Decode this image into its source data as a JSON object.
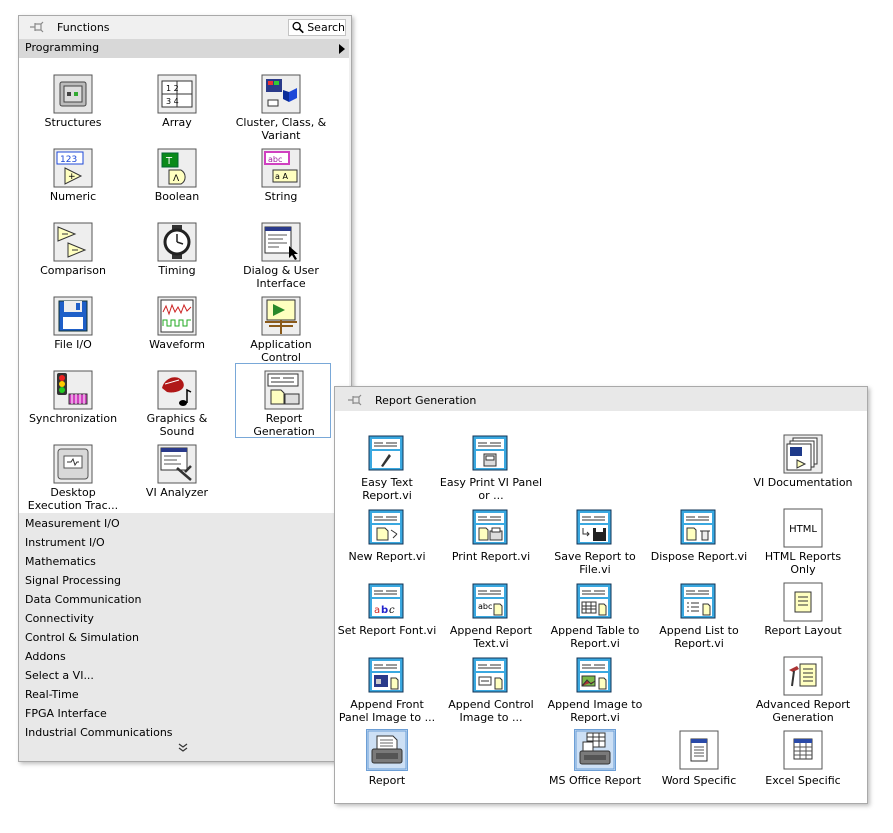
{
  "functions_palette": {
    "title": "Functions",
    "search_label": "Search",
    "programming_label": "Programming",
    "items": [
      {
        "label": "Structures",
        "icon": "structures-icon"
      },
      {
        "label": "Array",
        "icon": "array-icon"
      },
      {
        "label": "Cluster, Class, & Variant",
        "icon": "cluster-icon"
      },
      {
        "label": "Numeric",
        "icon": "numeric-icon"
      },
      {
        "label": "Boolean",
        "icon": "boolean-icon"
      },
      {
        "label": "String",
        "icon": "string-icon"
      },
      {
        "label": "Comparison",
        "icon": "comparison-icon"
      },
      {
        "label": "Timing",
        "icon": "timing-icon"
      },
      {
        "label": "Dialog & User Interface",
        "icon": "dialog-icon"
      },
      {
        "label": "File I/O",
        "icon": "file-io-icon"
      },
      {
        "label": "Waveform",
        "icon": "waveform-icon"
      },
      {
        "label": "Application Control",
        "icon": "app-control-icon"
      },
      {
        "label": "Synchronization",
        "icon": "sync-icon"
      },
      {
        "label": "Graphics & Sound",
        "icon": "graphics-sound-icon"
      },
      {
        "label": "Report Generation",
        "icon": "report-generation-icon"
      },
      {
        "label": "Desktop Execution Trac...",
        "icon": "desktop-trace-icon"
      },
      {
        "label": "VI Analyzer",
        "icon": "vi-analyzer-icon"
      }
    ],
    "categories": [
      "Measurement I/O",
      "Instrument I/O",
      "Mathematics",
      "Signal Processing",
      "Data Communication",
      "Connectivity",
      "Control & Simulation",
      "Addons",
      "Select a VI...",
      "Real-Time",
      "FPGA Interface",
      "Industrial Communications"
    ],
    "more_symbol": "⌄"
  },
  "report_palette": {
    "title": "Report Generation",
    "items": [
      {
        "label": "Easy Text Report.vi",
        "icon": "easy-text-report-icon"
      },
      {
        "label": "Easy Print VI Panel or ...",
        "icon": "easy-print-icon"
      },
      {
        "label": "VI Documentation",
        "icon": "vi-documentation-icon"
      },
      {
        "label": "New Report.vi",
        "icon": "new-report-icon"
      },
      {
        "label": "Print Report.vi",
        "icon": "print-report-icon"
      },
      {
        "label": "Save Report to File.vi",
        "icon": "save-report-icon"
      },
      {
        "label": "Dispose Report.vi",
        "icon": "dispose-report-icon"
      },
      {
        "label": "HTML Reports Only",
        "icon": "html-reports-icon",
        "text": "HTML"
      },
      {
        "label": "Set Report Font.vi",
        "icon": "set-font-icon"
      },
      {
        "label": "Append Report Text.vi",
        "icon": "append-text-icon"
      },
      {
        "label": "Append Table to Report.vi",
        "icon": "append-table-icon"
      },
      {
        "label": "Append List to Report.vi",
        "icon": "append-list-icon"
      },
      {
        "label": "Report Layout",
        "icon": "report-layout-icon"
      },
      {
        "label": "Append Front Panel Image to ...",
        "icon": "append-fp-image-icon"
      },
      {
        "label": "Append Control Image to ...",
        "icon": "append-control-image-icon"
      },
      {
        "label": "Append Image to Report.vi",
        "icon": "append-image-icon"
      },
      {
        "label": "Advanced Report Generation",
        "icon": "advanced-report-icon"
      },
      {
        "label": "Report",
        "icon": "report-icon"
      },
      {
        "label": "MS Office Report",
        "icon": "ms-office-report-icon"
      },
      {
        "label": "Word Specific",
        "icon": "word-specific-icon"
      },
      {
        "label": "Excel Specific",
        "icon": "excel-specific-icon"
      }
    ]
  }
}
